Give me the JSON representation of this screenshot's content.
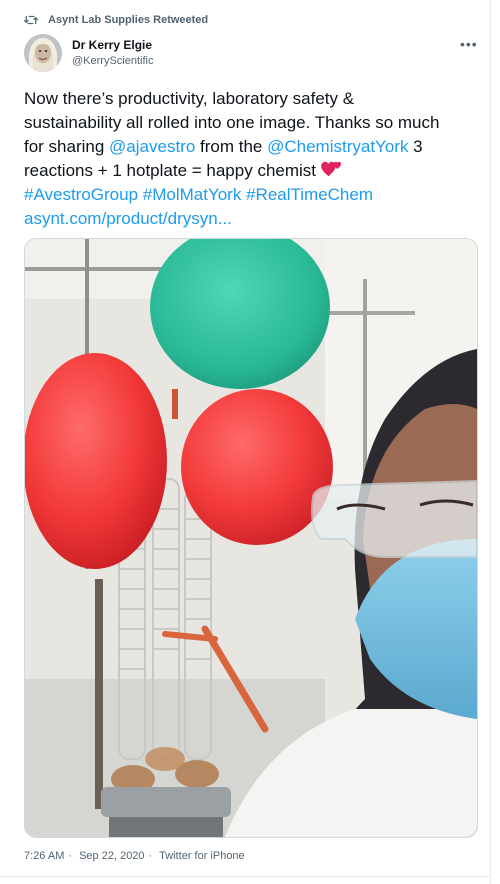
{
  "retweet": {
    "icon": "retweet-icon",
    "label": "Asynt Lab Supplies Retweeted"
  },
  "author": {
    "name": "Dr Kerry Elgie",
    "handle": "@KerryScientific",
    "avatar_icon": "avatar-photo"
  },
  "more_label": "•••",
  "tweet": {
    "line1": "Now there’s productivity, laboratory safety &",
    "line2": "sustainability all rolled into one image. Thanks so much",
    "line3_pre": "for sharing ",
    "mention1": "@ajavestro",
    "line3_mid": " from the ",
    "mention2": "@ChemistryatYork",
    "line3_post": " 3",
    "line4": "reactions + 1 hotplate = happy chemist ",
    "emoji": "two-hearts-icon",
    "hashtag1": "#AvestroGroup",
    "hashtag2": "#MolMatYork",
    "hashtag3": "#RealTimeChem",
    "url": "asynt.com/product/drysyn..."
  },
  "meta": {
    "time": "7:26 AM",
    "separator": "·",
    "date": "Sep 22, 2020",
    "source": "Twitter for iPhone"
  },
  "colors": {
    "link": "#1d9bf0",
    "secondary": "#536471",
    "text": "#0f1419"
  }
}
